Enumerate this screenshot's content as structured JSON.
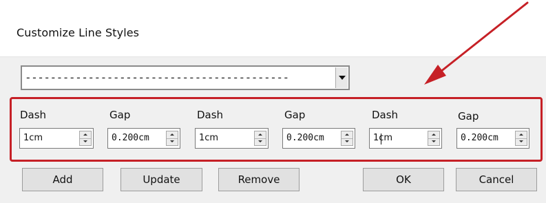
{
  "window": {
    "title": "Customize Line Styles"
  },
  "line_style_select": {
    "value": "------------------------------------------"
  },
  "fields": [
    {
      "label": "Dash",
      "value": "1cm"
    },
    {
      "label": "Gap",
      "value": "0.200cm"
    },
    {
      "label": "Dash",
      "value": "1cm"
    },
    {
      "label": "Gap",
      "value": "0.200cm"
    },
    {
      "label": "Dash",
      "value": "1cm"
    },
    {
      "label": "Gap",
      "value": "0.200cm"
    }
  ],
  "buttons": {
    "add": "Add",
    "update": "Update",
    "remove": "Remove",
    "ok": "OK",
    "cancel": "Cancel"
  },
  "colors": {
    "highlight": "#c62026",
    "arrow": "#c62026"
  },
  "icons": [
    "dropdown-arrow-icon",
    "spin-up-icon",
    "spin-down-icon",
    "annotation-arrow-icon"
  ]
}
